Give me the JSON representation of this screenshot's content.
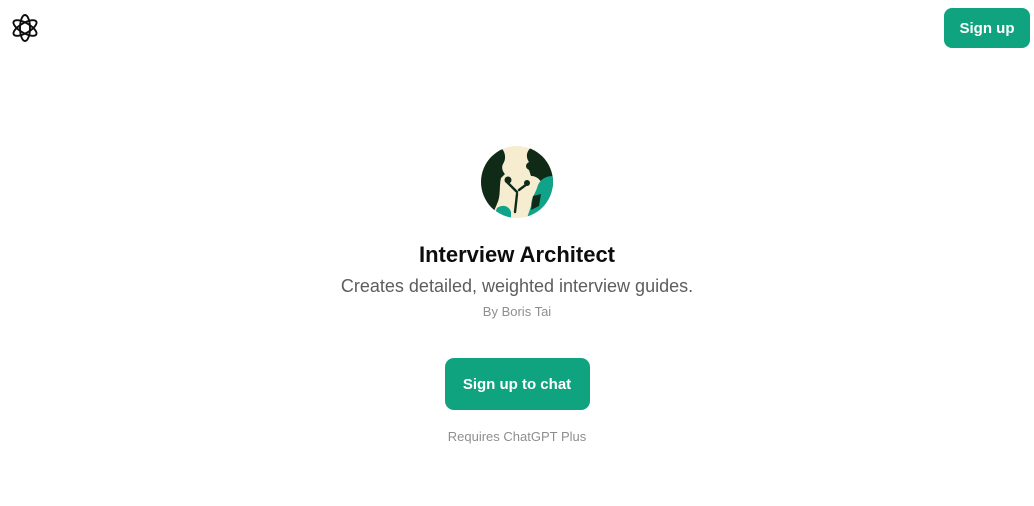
{
  "header": {
    "logo_icon": "openai-logo-icon",
    "signup_label": "Sign up"
  },
  "gpt": {
    "avatar_icon": "interview-silhouettes-avatar",
    "title": "Interview Architect",
    "description": "Creates detailed, weighted interview guides.",
    "author": "By Boris Tai",
    "cta_label": "Sign up to chat",
    "requirement": "Requires ChatGPT Plus"
  },
  "colors": {
    "accent": "#10a37f",
    "title": "#0d0d0d",
    "description": "#5d5d5d",
    "muted": "#8e8e8e",
    "avatar_background": "#f6ecd0",
    "avatar_dark": "#0f2a17",
    "avatar_teal": "#10a38a"
  }
}
